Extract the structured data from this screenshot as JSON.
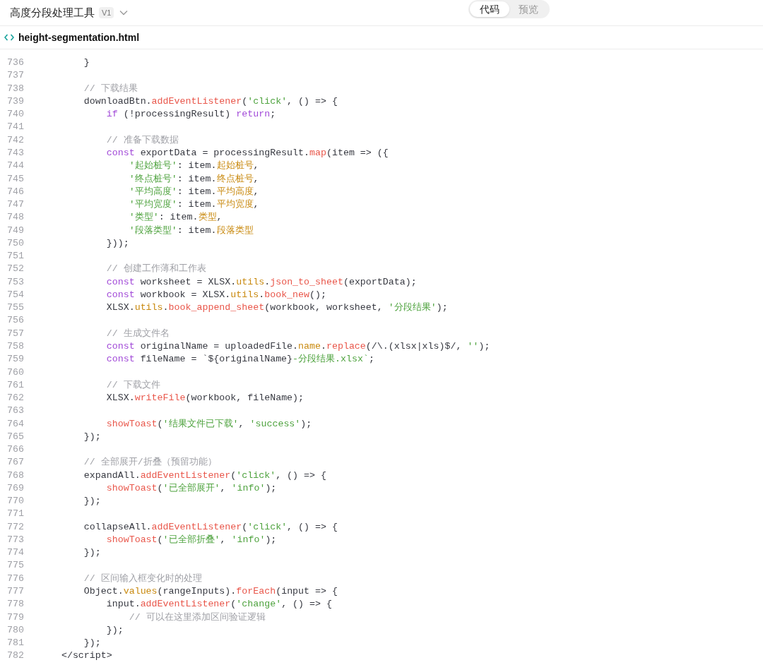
{
  "header": {
    "title": "高度分段处理工具",
    "version": "V1",
    "tabs": [
      {
        "label": "代码",
        "selected": true
      },
      {
        "label": "预览",
        "selected": false
      }
    ]
  },
  "file": {
    "name": "height-segmentation.html"
  },
  "code": [
    {
      "number": "736",
      "tokens": [
        {
          "kind": "p",
          "text": "        }"
        }
      ]
    },
    {
      "number": "737"
    },
    {
      "number": "738",
      "tokens": [
        {
          "kind": "c",
          "text": "        // 下载结果"
        }
      ]
    },
    {
      "number": "739",
      "tokens": [
        {
          "kind": "p",
          "text": "        downloadBtn."
        },
        {
          "kind": "f",
          "text": "addEventListener"
        },
        {
          "kind": "p",
          "text": "("
        },
        {
          "kind": "s",
          "text": "'click'"
        },
        {
          "kind": "p",
          "text": ", () => {"
        }
      ]
    },
    {
      "number": "740",
      "tokens": [
        {
          "kind": "k",
          "text": "            if"
        },
        {
          "kind": "p",
          "text": " (!processingResult) "
        },
        {
          "kind": "k",
          "text": "return"
        },
        {
          "kind": "p",
          "text": ";"
        }
      ]
    },
    {
      "number": "741"
    },
    {
      "number": "742",
      "tokens": [
        {
          "kind": "c",
          "text": "            // 准备下载数据"
        }
      ]
    },
    {
      "number": "743",
      "tokens": [
        {
          "kind": "k",
          "text": "            const"
        },
        {
          "kind": "p",
          "text": " exportData = processingResult."
        },
        {
          "kind": "f",
          "text": "map"
        },
        {
          "kind": "p",
          "text": "(item => ({"
        }
      ]
    },
    {
      "number": "744",
      "tokens": [
        {
          "kind": "s",
          "text": "                '起始桩号'"
        },
        {
          "kind": "p",
          "text": ": item."
        },
        {
          "kind": "o",
          "text": "起始桩号"
        },
        {
          "kind": "p",
          "text": ","
        }
      ]
    },
    {
      "number": "745",
      "tokens": [
        {
          "kind": "s",
          "text": "                '终点桩号'"
        },
        {
          "kind": "p",
          "text": ": item."
        },
        {
          "kind": "o",
          "text": "终点桩号"
        },
        {
          "kind": "p",
          "text": ","
        }
      ]
    },
    {
      "number": "746",
      "tokens": [
        {
          "kind": "s",
          "text": "                '平均高度'"
        },
        {
          "kind": "p",
          "text": ": item."
        },
        {
          "kind": "o",
          "text": "平均高度"
        },
        {
          "kind": "p",
          "text": ","
        }
      ]
    },
    {
      "number": "747",
      "tokens": [
        {
          "kind": "s",
          "text": "                '平均宽度'"
        },
        {
          "kind": "p",
          "text": ": item."
        },
        {
          "kind": "o",
          "text": "平均宽度"
        },
        {
          "kind": "p",
          "text": ","
        }
      ]
    },
    {
      "number": "748",
      "tokens": [
        {
          "kind": "s",
          "text": "                '类型'"
        },
        {
          "kind": "p",
          "text": ": item."
        },
        {
          "kind": "o",
          "text": "类型"
        },
        {
          "kind": "p",
          "text": ","
        }
      ]
    },
    {
      "number": "749",
      "tokens": [
        {
          "kind": "s",
          "text": "                '段落类型'"
        },
        {
          "kind": "p",
          "text": ": item."
        },
        {
          "kind": "o",
          "text": "段落类型"
        }
      ]
    },
    {
      "number": "750",
      "tokens": [
        {
          "kind": "p",
          "text": "            }));"
        }
      ]
    },
    {
      "number": "751"
    },
    {
      "number": "752",
      "tokens": [
        {
          "kind": "c",
          "text": "            // 创建工作薄和工作表"
        }
      ]
    },
    {
      "number": "753",
      "tokens": [
        {
          "kind": "k",
          "text": "            const"
        },
        {
          "kind": "p",
          "text": " worksheet = XLSX."
        },
        {
          "kind": "o",
          "text": "utils"
        },
        {
          "kind": "p",
          "text": "."
        },
        {
          "kind": "f",
          "text": "json_to_sheet"
        },
        {
          "kind": "p",
          "text": "(exportData);"
        }
      ]
    },
    {
      "number": "754",
      "tokens": [
        {
          "kind": "k",
          "text": "            const"
        },
        {
          "kind": "p",
          "text": " workbook = XLSX."
        },
        {
          "kind": "o",
          "text": "utils"
        },
        {
          "kind": "p",
          "text": "."
        },
        {
          "kind": "f",
          "text": "book_new"
        },
        {
          "kind": "p",
          "text": "();"
        }
      ]
    },
    {
      "number": "755",
      "tokens": [
        {
          "kind": "p",
          "text": "            XLSX."
        },
        {
          "kind": "o",
          "text": "utils"
        },
        {
          "kind": "p",
          "text": "."
        },
        {
          "kind": "f",
          "text": "book_append_sheet"
        },
        {
          "kind": "p",
          "text": "(workbook, worksheet, "
        },
        {
          "kind": "s",
          "text": "'分段结果'"
        },
        {
          "kind": "p",
          "text": ");"
        }
      ]
    },
    {
      "number": "756"
    },
    {
      "number": "757",
      "tokens": [
        {
          "kind": "c",
          "text": "            // 生成文件名"
        }
      ]
    },
    {
      "number": "758",
      "tokens": [
        {
          "kind": "k",
          "text": "            const"
        },
        {
          "kind": "p",
          "text": " originalName = uploadedFile."
        },
        {
          "kind": "o",
          "text": "name"
        },
        {
          "kind": "p",
          "text": "."
        },
        {
          "kind": "f",
          "text": "replace"
        },
        {
          "kind": "p",
          "text": "(/\\.(xlsx|xls)$/, "
        },
        {
          "kind": "s",
          "text": "''"
        },
        {
          "kind": "p",
          "text": ");"
        }
      ]
    },
    {
      "number": "759",
      "tokens": [
        {
          "kind": "k",
          "text": "            const"
        },
        {
          "kind": "p",
          "text": " fileName = `${originalName}"
        },
        {
          "kind": "s",
          "text": "-分段结果.xlsx`"
        },
        {
          "kind": "p",
          "text": ";"
        }
      ]
    },
    {
      "number": "760"
    },
    {
      "number": "761",
      "tokens": [
        {
          "kind": "c",
          "text": "            // 下载文件"
        }
      ]
    },
    {
      "number": "762",
      "tokens": [
        {
          "kind": "p",
          "text": "            XLSX."
        },
        {
          "kind": "f",
          "text": "writeFile"
        },
        {
          "kind": "p",
          "text": "(workbook, fileName);"
        }
      ]
    },
    {
      "number": "763"
    },
    {
      "number": "764",
      "tokens": [
        {
          "kind": "f",
          "text": "            showToast"
        },
        {
          "kind": "p",
          "text": "("
        },
        {
          "kind": "s",
          "text": "'结果文件已下载'"
        },
        {
          "kind": "p",
          "text": ", "
        },
        {
          "kind": "s",
          "text": "'success'"
        },
        {
          "kind": "p",
          "text": ");"
        }
      ]
    },
    {
      "number": "765",
      "tokens": [
        {
          "kind": "p",
          "text": "        });"
        }
      ]
    },
    {
      "number": "766"
    },
    {
      "number": "767",
      "tokens": [
        {
          "kind": "c",
          "text": "        // 全部展开/折叠（预留功能）"
        }
      ]
    },
    {
      "number": "768",
      "tokens": [
        {
          "kind": "p",
          "text": "        expandAll."
        },
        {
          "kind": "f",
          "text": "addEventListener"
        },
        {
          "kind": "p",
          "text": "("
        },
        {
          "kind": "s",
          "text": "'click'"
        },
        {
          "kind": "p",
          "text": ", () => {"
        }
      ]
    },
    {
      "number": "769",
      "tokens": [
        {
          "kind": "f",
          "text": "            showToast"
        },
        {
          "kind": "p",
          "text": "("
        },
        {
          "kind": "s",
          "text": "'已全部展开'"
        },
        {
          "kind": "p",
          "text": ", "
        },
        {
          "kind": "s",
          "text": "'info'"
        },
        {
          "kind": "p",
          "text": ");"
        }
      ]
    },
    {
      "number": "770",
      "tokens": [
        {
          "kind": "p",
          "text": "        });"
        }
      ]
    },
    {
      "number": "771"
    },
    {
      "number": "772",
      "tokens": [
        {
          "kind": "p",
          "text": "        collapseAll."
        },
        {
          "kind": "f",
          "text": "addEventListener"
        },
        {
          "kind": "p",
          "text": "("
        },
        {
          "kind": "s",
          "text": "'click'"
        },
        {
          "kind": "p",
          "text": ", () => {"
        }
      ]
    },
    {
      "number": "773",
      "tokens": [
        {
          "kind": "f",
          "text": "            showToast"
        },
        {
          "kind": "p",
          "text": "("
        },
        {
          "kind": "s",
          "text": "'已全部折叠'"
        },
        {
          "kind": "p",
          "text": ", "
        },
        {
          "kind": "s",
          "text": "'info'"
        },
        {
          "kind": "p",
          "text": ");"
        }
      ]
    },
    {
      "number": "774",
      "tokens": [
        {
          "kind": "p",
          "text": "        });"
        }
      ]
    },
    {
      "number": "775"
    },
    {
      "number": "776",
      "tokens": [
        {
          "kind": "c",
          "text": "        // 区间输入框变化时的处理"
        }
      ]
    },
    {
      "number": "777",
      "tokens": [
        {
          "kind": "p",
          "text": "        Object."
        },
        {
          "kind": "o",
          "text": "values"
        },
        {
          "kind": "p",
          "text": "(rangeInputs)."
        },
        {
          "kind": "f",
          "text": "forEach"
        },
        {
          "kind": "p",
          "text": "(input => {"
        }
      ]
    },
    {
      "number": "778",
      "tokens": [
        {
          "kind": "p",
          "text": "            input."
        },
        {
          "kind": "f",
          "text": "addEventListener"
        },
        {
          "kind": "p",
          "text": "("
        },
        {
          "kind": "s",
          "text": "'change'"
        },
        {
          "kind": "p",
          "text": ", () => {"
        }
      ]
    },
    {
      "number": "779",
      "tokens": [
        {
          "kind": "c",
          "text": "                // 可以在这里添加区间验证逻辑"
        }
      ]
    },
    {
      "number": "780",
      "tokens": [
        {
          "kind": "p",
          "text": "            });"
        }
      ]
    },
    {
      "number": "781",
      "tokens": [
        {
          "kind": "p",
          "text": "        });"
        }
      ]
    },
    {
      "number": "782",
      "tokens": [
        {
          "kind": "p",
          "text": "    </script>"
        }
      ]
    }
  ]
}
